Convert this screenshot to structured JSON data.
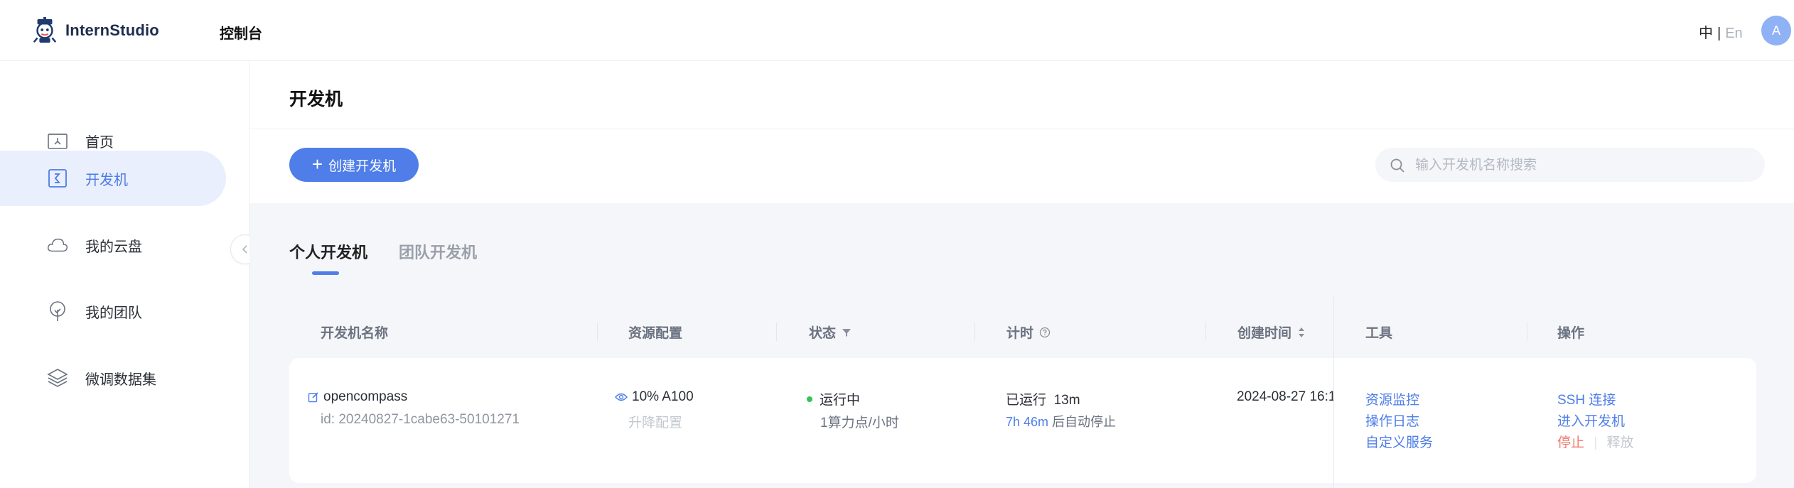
{
  "app": {
    "name": "InternStudio",
    "console_label": "控制台"
  },
  "header": {
    "lang_zh": "中",
    "lang_sep": "|",
    "lang_en": "En",
    "avatar_initial": "A"
  },
  "sidebar": {
    "items": [
      {
        "label": "首页",
        "icon": "home-icon"
      },
      {
        "label": "开发机",
        "icon": "terminal-icon",
        "active": true
      },
      {
        "label": "我的云盘",
        "icon": "cloud-icon"
      },
      {
        "label": "我的团队",
        "icon": "tree-icon"
      },
      {
        "label": "微调数据集",
        "icon": "layers-icon"
      }
    ]
  },
  "page": {
    "title": "开发机",
    "create_button": "创建开发机",
    "search_placeholder": "输入开发机名称搜索",
    "tabs": [
      {
        "label": "个人开发机",
        "active": true
      },
      {
        "label": "团队开发机",
        "active": false
      }
    ]
  },
  "table": {
    "columns": {
      "name": "开发机名称",
      "resource": "资源配置",
      "status": "状态",
      "timer": "计时",
      "created": "创建时间",
      "tools": "工具",
      "actions": "操作"
    },
    "rows": [
      {
        "name": "opencompass",
        "id": "id: 20240827-1cabe63-50101271",
        "resource": "10% A100",
        "resource_action": "升降配置",
        "status": "运行中",
        "status_color": "#36c25a",
        "price": "1算力点/小时",
        "running_label": "已运行",
        "running_time": "13m",
        "auto_stop_time": "7h 46m",
        "auto_stop_suffix": "后自动停止",
        "created": "2024-08-27 16:1",
        "tools": [
          "资源监控",
          "操作日志",
          "自定义服务"
        ],
        "actions": {
          "ssh": "SSH 连接",
          "enter": "进入开发机",
          "stop": "停止",
          "release": "释放"
        }
      }
    ]
  },
  "colors": {
    "primary": "#4f7ee9",
    "danger": "#f07a6e",
    "active_bg": "#e9effc"
  }
}
